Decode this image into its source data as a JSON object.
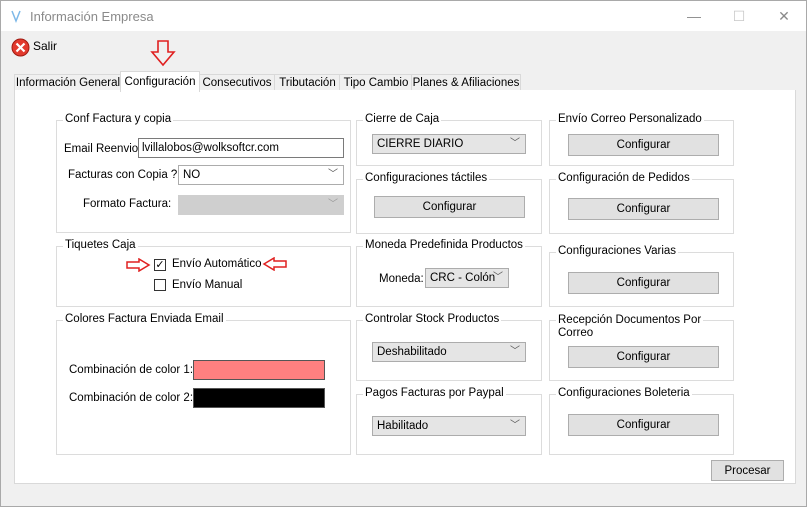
{
  "window": {
    "title": "Información Empresa",
    "minimize": "—",
    "maximize": "☐",
    "close": "✕"
  },
  "toolbar": {
    "exit_label": "Salir"
  },
  "tabs": [
    {
      "label": "Información General"
    },
    {
      "label": "Configuración"
    },
    {
      "label": "Consecutivos"
    },
    {
      "label": "Tributación"
    },
    {
      "label": "Tipo Cambio"
    },
    {
      "label": "Planes & Afiliaciones"
    }
  ],
  "conf_factura": {
    "title": "Conf Factura y copia",
    "email_label": "Email Reenvio:",
    "email_value": "lvillalobos@wolksoftcr.com",
    "copias_label": "Facturas con Copia ?",
    "copias_value": "NO",
    "formato_label": "Formato Factura:",
    "formato_value": ""
  },
  "tiquetes": {
    "title": "Tiquetes Caja",
    "auto_label": "Envío Automático",
    "auto_checked": "✓",
    "manual_label": "Envío Manual"
  },
  "colores": {
    "title": "Colores Factura Enviada Email",
    "color1_label": "Combinación de color 1:",
    "color1": "#ff8080",
    "color2_label": "Combinación de color 2:",
    "color2": "#000000"
  },
  "cierre": {
    "title": "Cierre de Caja",
    "value": "CIERRE DIARIO"
  },
  "tactiles": {
    "title": "Configuraciones táctiles",
    "button": "Configurar"
  },
  "moneda": {
    "title": "Moneda Predefinida Productos",
    "label": "Moneda:",
    "value": "CRC - Colón"
  },
  "stock": {
    "title": "Controlar Stock Productos",
    "value": "Deshabilitado"
  },
  "paypal": {
    "title": "Pagos Facturas por Paypal",
    "value": "Habilitado"
  },
  "correo": {
    "title": "Envío Correo Personalizado",
    "button": "Configurar"
  },
  "pedidos": {
    "title": "Configuración de Pedidos",
    "button": "Configurar"
  },
  "varias": {
    "title": "Configuraciones Varias",
    "button": "Configurar"
  },
  "recepcion": {
    "title_line1": "Recepción Documentos Por",
    "title_line2": "Correo",
    "button": "Configurar"
  },
  "boleteria": {
    "title": "Configuraciones Boleteria",
    "button": "Configurar"
  },
  "procesar_label": "Procesar",
  "colors": {
    "annotation_red": "#e02020",
    "exit_icon_red": "#e23a2e"
  }
}
